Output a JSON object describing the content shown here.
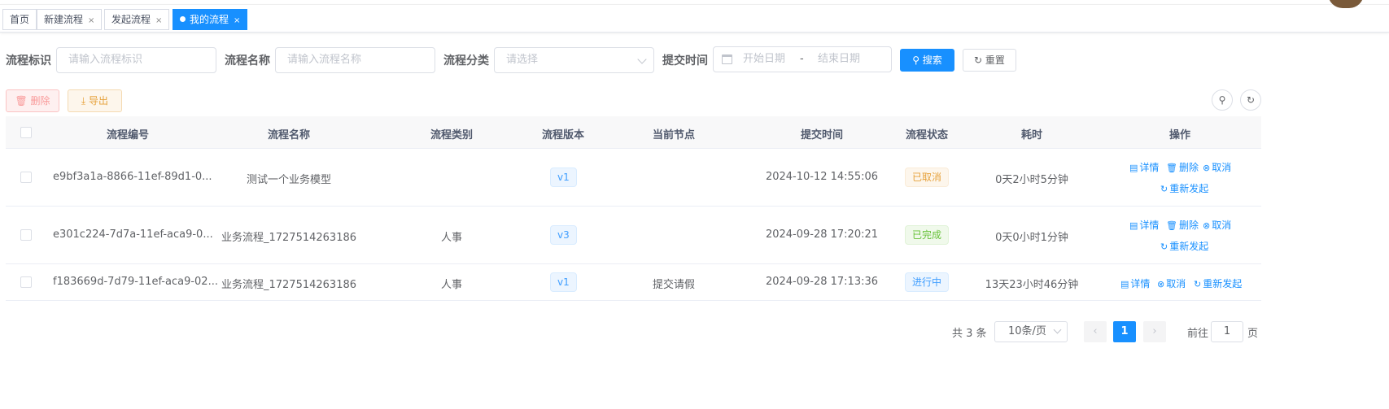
{
  "tabs": [
    {
      "label": "首页",
      "closable": false,
      "active": false
    },
    {
      "label": "新建流程",
      "closable": true,
      "active": false
    },
    {
      "label": "发起流程",
      "closable": true,
      "active": false
    },
    {
      "label": "我的流程",
      "closable": true,
      "active": true
    }
  ],
  "tab_close_glyph": "×",
  "search": {
    "key_label": "流程标识",
    "key_placeholder": "请输入流程标识",
    "name_label": "流程名称",
    "name_placeholder": "请输入流程名称",
    "category_label": "流程分类",
    "category_placeholder": "请选择",
    "time_label": "提交时间",
    "start_placeholder": "开始日期",
    "range_separator": "-",
    "end_placeholder": "结束日期",
    "search_button": "搜索",
    "reset_button": "重置"
  },
  "toolbar": {
    "delete_button": "删除",
    "export_button": "导出"
  },
  "table": {
    "headers": [
      "流程编号",
      "流程名称",
      "流程类别",
      "流程版本",
      "当前节点",
      "提交时间",
      "流程状态",
      "耗时",
      "操作"
    ],
    "rows": [
      {
        "id": "e9bf3a1a-8866-11ef-89d1-0...",
        "name": "测试一个业务模型",
        "category": "",
        "version": "v1",
        "node": "",
        "time": "2024-10-12 14:55:06",
        "status": "已取消",
        "status_type": "orange",
        "duration": "0天2小时5分钟",
        "ops": [
          "详情",
          "删除",
          "取消",
          "重新发起"
        ]
      },
      {
        "id": "e301c224-7d7a-11ef-aca9-0...",
        "name": "业务流程_1727514263186",
        "category": "人事",
        "version": "v3",
        "node": "",
        "time": "2024-09-28 17:20:21",
        "status": "已完成",
        "status_type": "green",
        "duration": "0天0小时1分钟",
        "ops": [
          "详情",
          "删除",
          "取消",
          "重新发起"
        ]
      },
      {
        "id": "f183669d-7d79-11ef-aca9-02...",
        "name": "业务流程_1727514263186",
        "category": "人事",
        "version": "v1",
        "node": "提交请假",
        "time": "2024-09-28 17:13:36",
        "status": "进行中",
        "status_type": "blue",
        "duration": "13天23小时46分钟",
        "ops": [
          "详情",
          "取消",
          "重新发起"
        ]
      }
    ]
  },
  "pagination": {
    "total_text": "共 3 条",
    "page_size": "10条/页",
    "current_page": "1",
    "goto_label": "前往",
    "goto_value": "1",
    "page_unit": "页"
  },
  "colors": {
    "primary": "#1890ff",
    "danger": "#f56c6c",
    "warning": "#e6a23c",
    "success": "#67c23a"
  }
}
